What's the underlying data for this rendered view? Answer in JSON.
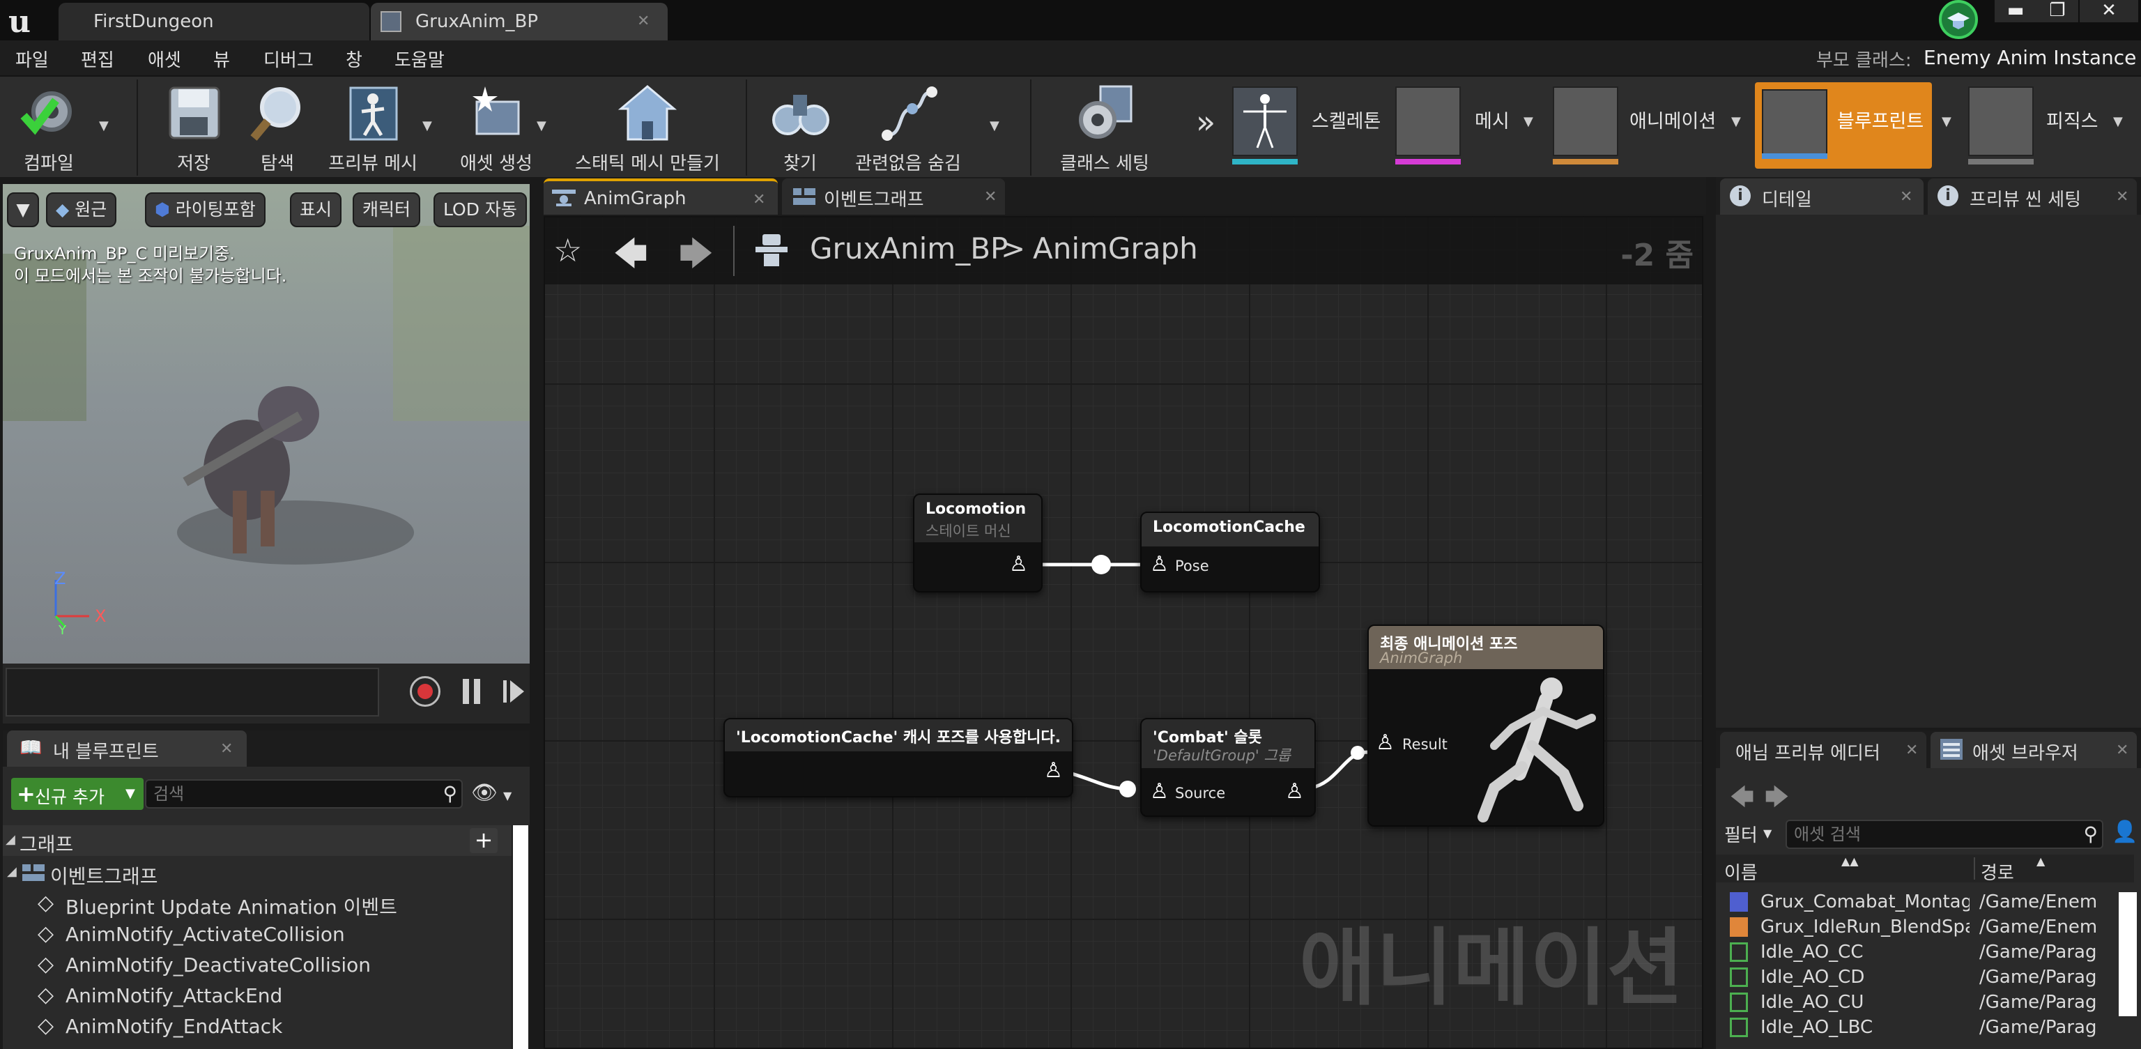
{
  "document_tabs": [
    {
      "label": "FirstDungeon"
    },
    {
      "label": "GruxAnim_BP"
    }
  ],
  "window": {
    "minimize": "▬",
    "restore": "❐",
    "close": "✕"
  },
  "menu": [
    "파일",
    "편집",
    "애셋",
    "뷰",
    "디버그",
    "창",
    "도움말"
  ],
  "parent_class": {
    "label": "부모 클래스:",
    "value": "Enemy Anim Instance"
  },
  "toolbar": {
    "compile": "컴파일",
    "save": "저장",
    "browse": "탐색",
    "preview_mesh": "프리뷰 메시",
    "make_asset": "애셋 생성",
    "make_static_mesh": "스태틱 메시 만들기",
    "find": "찾기",
    "hide_unrelated": "관련없음 숨김",
    "class_settings": "클래스 세팅"
  },
  "modes": [
    {
      "label": "스켈레톤",
      "color": "#2fb5c7"
    },
    {
      "label": "메시",
      "color": "#d63cd6"
    },
    {
      "label": "애니메이션",
      "color": "#d08a3a"
    },
    {
      "label": "블루프린트",
      "color": "#4a90d9",
      "active": true
    },
    {
      "label": "피직스",
      "color": "#777777"
    }
  ],
  "viewport": {
    "buttons": [
      "원근",
      "라이팅포함",
      "표시",
      "캐릭터",
      "LOD 자동"
    ],
    "line1": "GruxAnim_BP_C 미리보기중.",
    "line2": "이 모드에서는 본 조작이 불가능합니다.",
    "axis_z": "Z",
    "axis_x": "X",
    "axis_y": "Y"
  },
  "my_blueprint": {
    "tab": "내 블루프린트",
    "add_new": "신규 추가",
    "search_placeholder": "검색",
    "graphs_header": "그래프",
    "event_graph": "이벤트그래프",
    "items": [
      "Blueprint Update Animation 이벤트",
      "AnimNotify_ActivateCollision",
      "AnimNotify_DeactivateCollision",
      "AnimNotify_AttackEnd",
      "AnimNotify_EndAttack"
    ]
  },
  "graph_tabs": [
    {
      "label": "AnimGraph"
    },
    {
      "label": "이벤트그래프"
    }
  ],
  "breadcrumb": {
    "root": "GruxAnim_BP",
    "sep": ">",
    "leaf": "AnimGraph",
    "zoom": "-2 줌"
  },
  "nodes": {
    "locomotion": {
      "title": "Locomotion",
      "subtitle": "스테이트 머신"
    },
    "cache": {
      "title": "LocomotionCache",
      "pin": "Pose"
    },
    "use_cache": {
      "title": "'LocomotionCache' 캐시 포즈를 사용합니다."
    },
    "slot": {
      "title": "'Combat' 슬롯",
      "subtitle": "'DefaultGroup' 그룹",
      "pin": "Source"
    },
    "output": {
      "title": "최종 애니메이션 포즈",
      "subtitle": "AnimGraph",
      "pin": "Result"
    }
  },
  "graph_watermark": "애니메이션",
  "details_tabs": [
    {
      "label": "디테일"
    },
    {
      "label": "프리뷰 씬 세팅"
    }
  ],
  "asset_tabs": [
    {
      "label": "애님 프리뷰 에디터"
    },
    {
      "label": "애셋 브라우저"
    }
  ],
  "asset_browser": {
    "filter": "필터",
    "search_placeholder": "애셋 검색",
    "col_name": "이름",
    "col_path": "경로",
    "rows": [
      {
        "name": "Grux_Comabat_Montage",
        "path": "/Game/Enemi",
        "color": "#4f5fd0"
      },
      {
        "name": "Grux_IdleRun_BlendSpac",
        "path": "/Game/Enemi",
        "color": "#e0863a"
      },
      {
        "name": "Idle_AO_CC",
        "path": "/Game/Parago",
        "color": "#4caf50"
      },
      {
        "name": "Idle_AO_CD",
        "path": "/Game/Parago",
        "color": "#4caf50"
      },
      {
        "name": "Idle_AO_CU",
        "path": "/Game/Parago",
        "color": "#4caf50"
      },
      {
        "name": "Idle_AO_LBC",
        "path": "/Game/Parago",
        "color": "#4caf50"
      }
    ]
  }
}
